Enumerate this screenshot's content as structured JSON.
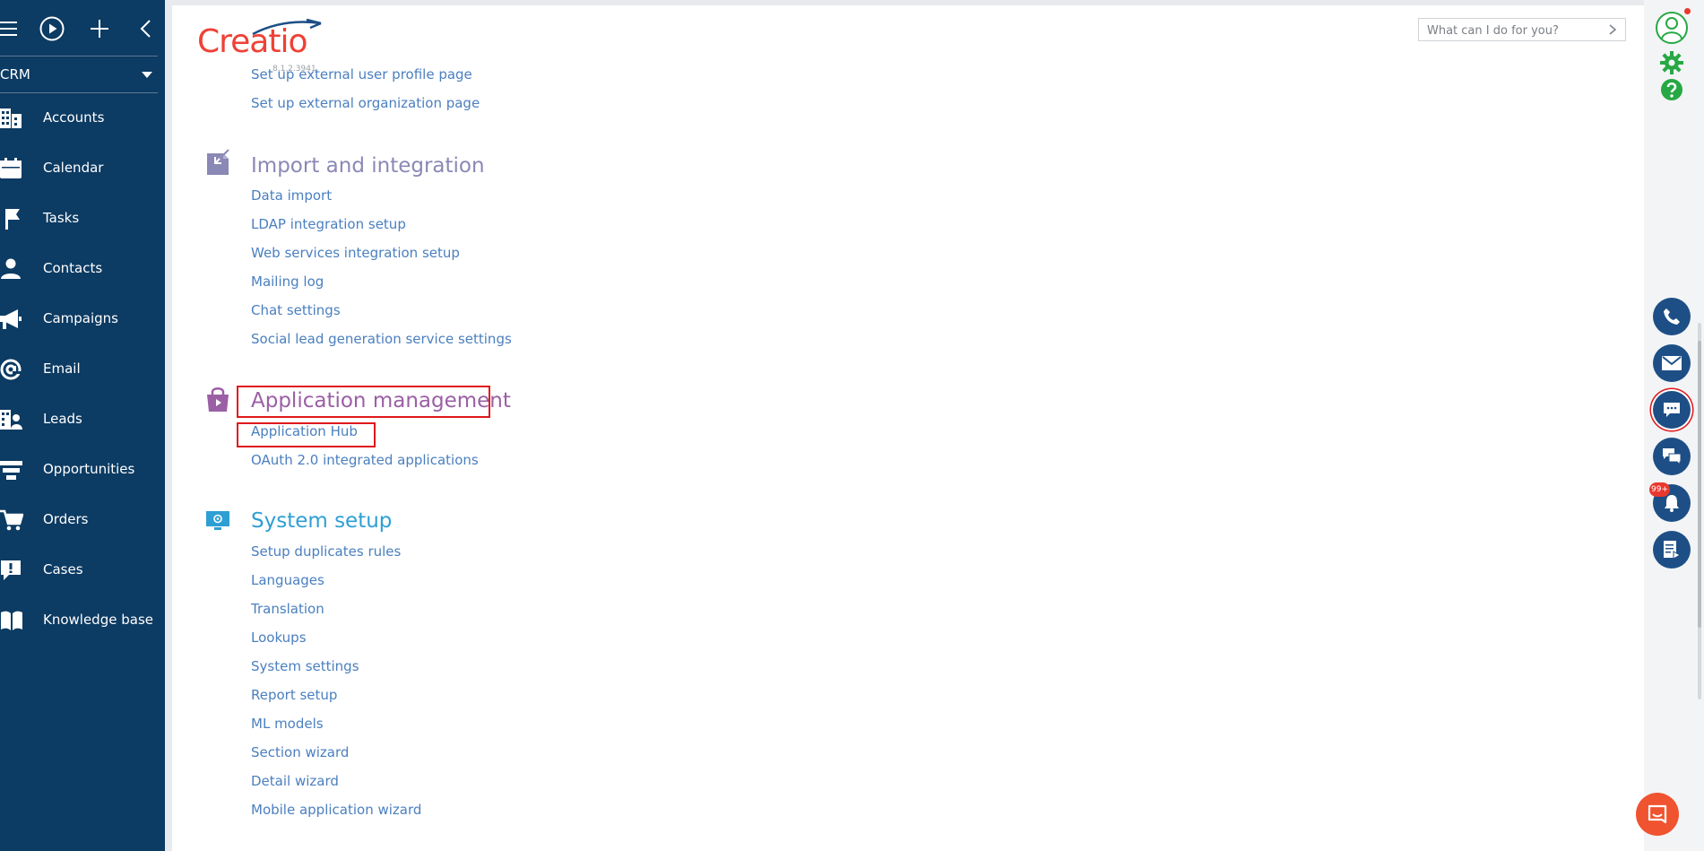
{
  "workspace": {
    "label": "CRM"
  },
  "nav": [
    {
      "label": "Accounts",
      "icon": "building-icon"
    },
    {
      "label": "Calendar",
      "icon": "calendar-icon"
    },
    {
      "label": "Tasks",
      "icon": "flag-icon"
    },
    {
      "label": "Contacts",
      "icon": "person-icon"
    },
    {
      "label": "Campaigns",
      "icon": "megaphone-icon"
    },
    {
      "label": "Email",
      "icon": "at-icon"
    },
    {
      "label": "Leads",
      "icon": "leads-icon"
    },
    {
      "label": "Opportunities",
      "icon": "funnel-icon"
    },
    {
      "label": "Orders",
      "icon": "cart-icon"
    },
    {
      "label": "Cases",
      "icon": "alert-bubble-icon"
    },
    {
      "label": "Knowledge base",
      "icon": "book-icon"
    }
  ],
  "logo": {
    "text": "Creatio",
    "version": "8.1.2.3941"
  },
  "search": {
    "placeholder": "What can I do for you?"
  },
  "sections": [
    {
      "title": "",
      "links": [
        "Set up external user profile page",
        "Set up external organization page"
      ]
    },
    {
      "title": "Import and integration",
      "color": "#8a88b5",
      "links": [
        "Data import",
        "LDAP integration setup",
        "Web services integration setup",
        "Mailing log",
        "Chat settings",
        "Social lead generation service settings"
      ]
    },
    {
      "title": "Application management",
      "color": "#9b5fa5",
      "links": [
        "Application Hub",
        "OAuth 2.0 integrated applications"
      ]
    },
    {
      "title": "System setup",
      "color": "#2e9fd4",
      "links": [
        "Setup duplicates rules",
        "Languages",
        "Translation",
        "Lookups",
        "System settings",
        "Report setup",
        "ML models",
        "Section wizard",
        "Detail wizard",
        "Mobile application wizard"
      ]
    }
  ],
  "notifications": {
    "badge": "99+"
  },
  "colors": {
    "sidebar": "#0c3b63",
    "link": "#4a7fbf",
    "highlight": "#e0181b",
    "rail_button": "#1d4f86",
    "accent_green": "#27a844"
  }
}
